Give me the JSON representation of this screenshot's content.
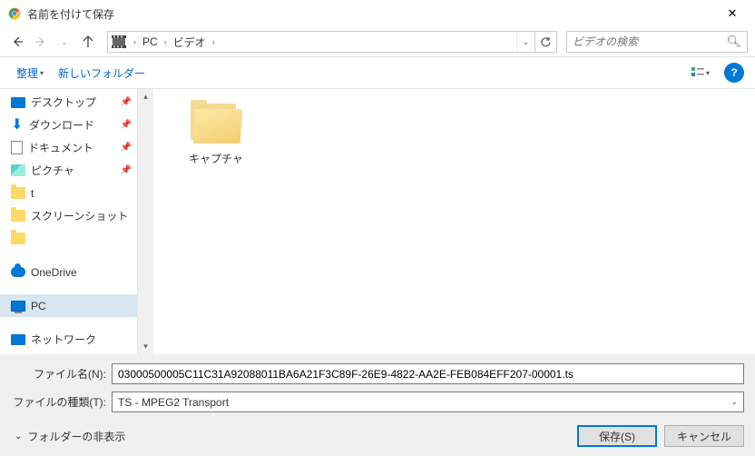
{
  "window": {
    "title": "名前を付けて保存"
  },
  "breadcrumb": {
    "items": [
      "PC",
      "ビデオ"
    ]
  },
  "search": {
    "placeholder": "ビデオの検索"
  },
  "toolbar": {
    "organize": "整理",
    "new_folder": "新しいフォルダー"
  },
  "tree": {
    "desktop": "デスクトップ",
    "downloads": "ダウンロード",
    "documents": "ドキュメント",
    "pictures": "ピクチャ",
    "t": "t",
    "screenshots": "スクリーンショット",
    "onedrive": "OneDrive",
    "pc": "PC",
    "network": "ネットワーク"
  },
  "content": {
    "folders": [
      {
        "name": "キャプチャ"
      }
    ]
  },
  "filename": {
    "label": "ファイル名(N):",
    "value": "03000500005C11C31A92088011BA6A21F3C89F-26E9-4822-AA2E-FEB084EFF207-00001.ts"
  },
  "filetype": {
    "label": "ファイルの種類(T):",
    "value": "TS - MPEG2 Transport"
  },
  "actions": {
    "hide_folders": "フォルダーの非表示",
    "save": "保存(S)",
    "cancel": "キャンセル"
  }
}
